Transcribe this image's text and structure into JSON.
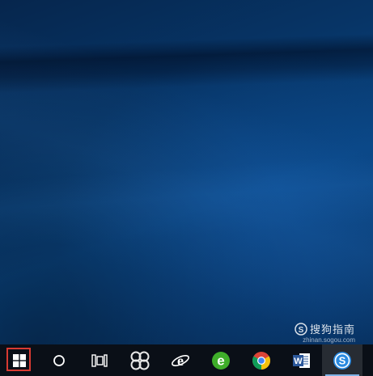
{
  "desktop": {
    "wallpaper": "windows-10-blue-light",
    "colors": {
      "wallpaper_dark": "#052a55",
      "wallpaper_mid": "#0a4684",
      "taskbar": "#0a0f17",
      "highlight": "#d93a32"
    }
  },
  "watermark": {
    "brand": "搜狗指南",
    "url": "zhinan.sogou.com"
  },
  "taskbar": {
    "items": [
      {
        "name": "start-button",
        "icon": "windows-logo-icon",
        "highlighted": true
      },
      {
        "name": "cortana-search-button",
        "icon": "circle-icon"
      },
      {
        "name": "task-view-button",
        "icon": "task-view-icon"
      },
      {
        "name": "app-pinwheel-button",
        "icon": "pinwheel-icon"
      },
      {
        "name": "internet-explorer-button",
        "icon": "ie-icon"
      },
      {
        "name": "360-browser-button",
        "icon": "green-e-icon"
      },
      {
        "name": "chrome-button",
        "icon": "chrome-icon"
      },
      {
        "name": "word-button",
        "icon": "word-icon"
      },
      {
        "name": "sogou-input-button",
        "icon": "sogou-icon",
        "active": true
      }
    ]
  }
}
